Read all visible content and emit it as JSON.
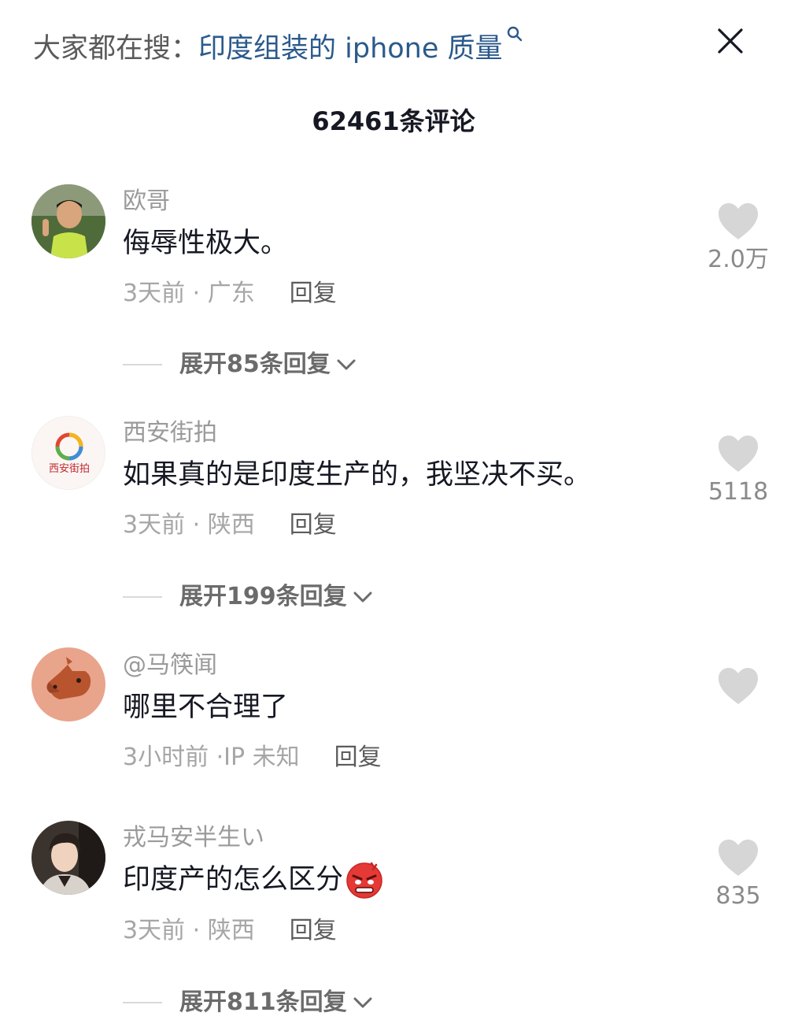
{
  "header": {
    "hot_search_label": "大家都在搜：",
    "hot_search_query": "印度组装的 iphone 质量",
    "search_icon": "search-icon",
    "close_icon": "close-icon"
  },
  "comment_count_title": "62461条评论",
  "comments": [
    {
      "username": "欧哥",
      "text": "侮辱性极大。",
      "time": "3天前",
      "location": "广东",
      "reply_label": "回复",
      "likes": "2.0万",
      "expand_label": "展开85条回复"
    },
    {
      "username": "西安街拍",
      "text": "如果真的是印度生产的，我坚决不买。",
      "time": "3天前",
      "location": "陕西",
      "reply_label": "回复",
      "likes": "5118",
      "expand_label": "展开199条回复",
      "avatar_text": "西安街拍"
    },
    {
      "username": "@马筷闻",
      "text": "哪里不合理了",
      "time": "3小时前",
      "location": "IP 未知",
      "reply_label": "回复",
      "likes": ""
    },
    {
      "username": "戎马安半生い",
      "text": "印度产的怎么区分",
      "emoji": "angry-face-emoji",
      "time": "3天前",
      "location": "陕西",
      "reply_label": "回复",
      "likes": "835",
      "expand_label": "展开811条回复"
    }
  ],
  "colors": {
    "link": "#2b5a8c",
    "username": "#9a9a9a",
    "meta": "#a6a6a6",
    "heart": "#d6d6d6",
    "text": "#161823"
  }
}
